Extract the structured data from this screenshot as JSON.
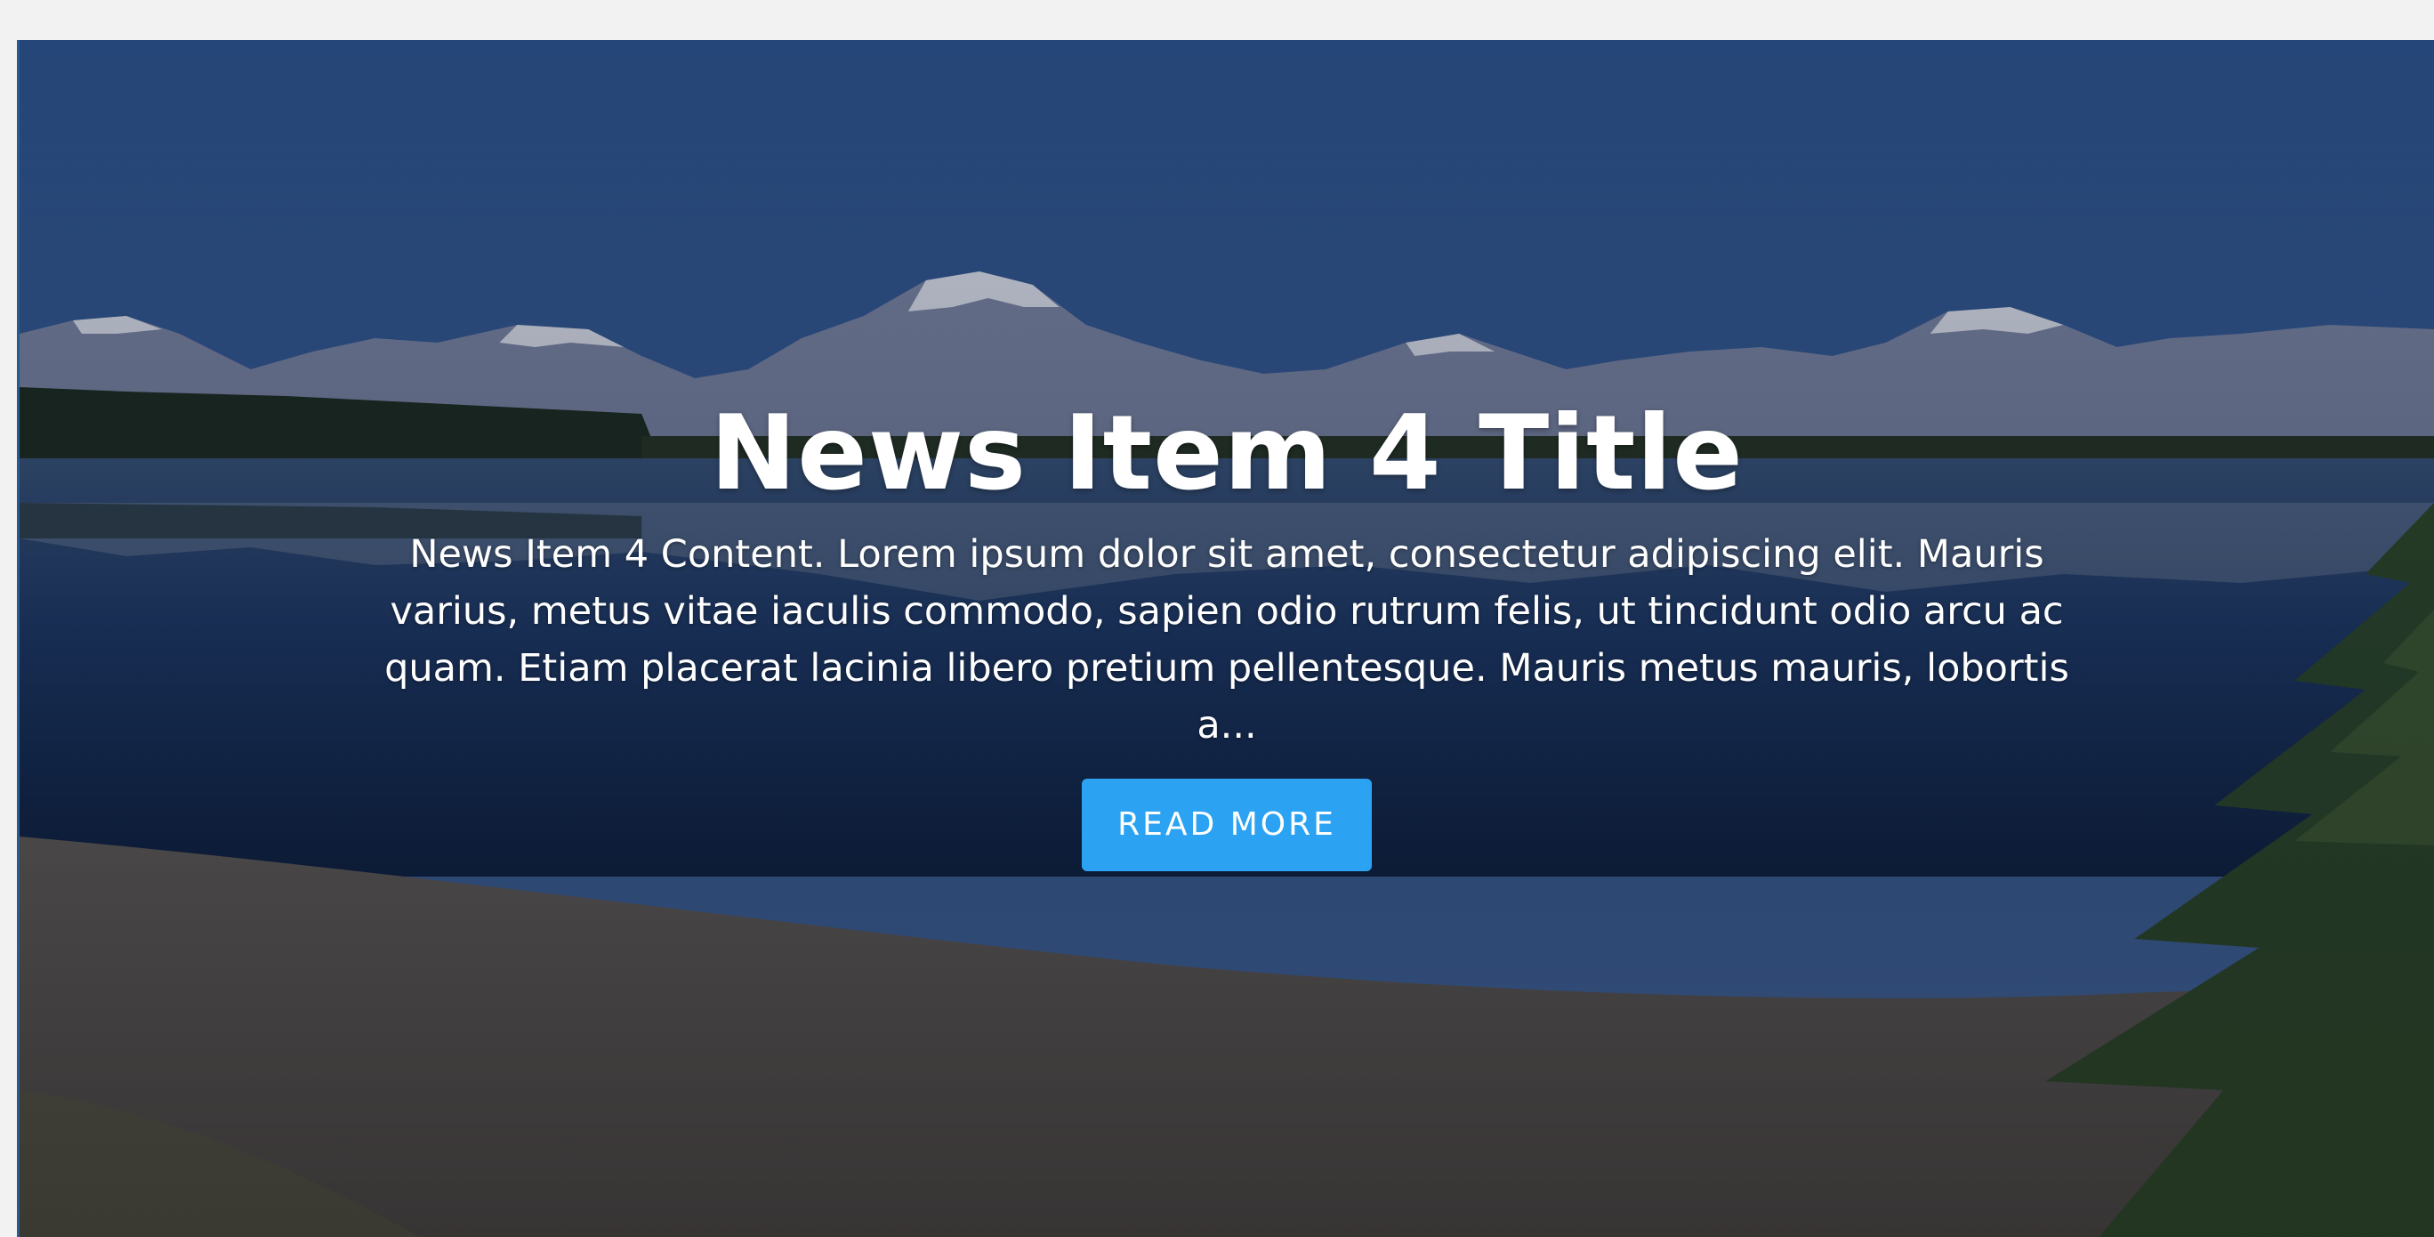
{
  "hero": {
    "title": "News Item 4 Title",
    "content": "News Item 4 Content. Lorem ipsum dolor sit amet, consectetur adipiscing elit. Mauris varius, metus vitae iaculis commodo, sapien odio rutrum felis, ut tincidunt odio arcu ac quam. Etiam placerat lacinia libero pretium pellentesque. Mauris metus mauris, lobortis a...",
    "button_label": "Read More",
    "button_color": "#2ca3f2",
    "background_image": "mountain-lake-landscape"
  }
}
